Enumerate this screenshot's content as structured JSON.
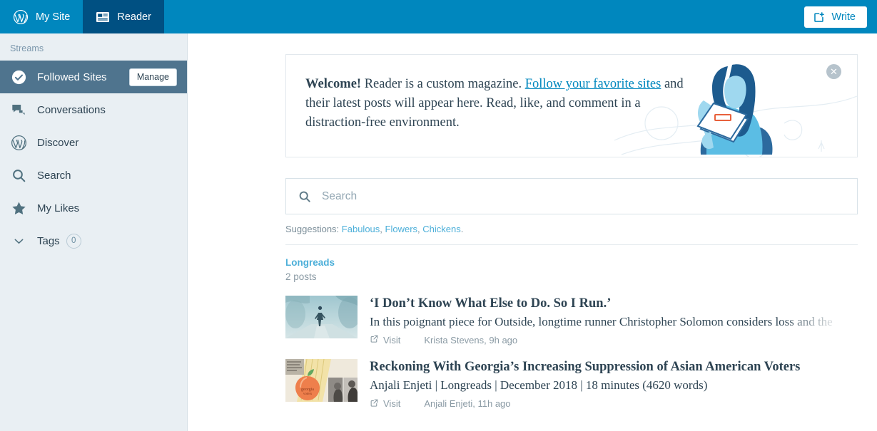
{
  "masterbar": {
    "my_site": "My Site",
    "reader": "Reader",
    "write": "Write",
    "icons": {
      "wordpress": "wordpress-icon",
      "reader": "reader-icon",
      "write": "write-icon"
    }
  },
  "sidebar": {
    "heading": "Streams",
    "items": [
      {
        "label": "Followed Sites",
        "icon": "checkmark-circle-icon",
        "active": true,
        "action_label": "Manage"
      },
      {
        "label": "Conversations",
        "icon": "comments-icon",
        "active": false
      },
      {
        "label": "Discover",
        "icon": "wordpress-icon",
        "active": false
      },
      {
        "label": "Search",
        "icon": "search-icon",
        "active": false
      },
      {
        "label": "My Likes",
        "icon": "star-icon",
        "active": false
      }
    ],
    "tags": {
      "label": "Tags",
      "count": "0",
      "icon": "chevron-down-icon"
    }
  },
  "welcome": {
    "bold": "Welcome!",
    "text_before_link": " Reader is a custom magazine. ",
    "link": "Follow your favorite sites",
    "text_after_link": " and their latest posts will appear here. Read, like, and comment in a distraction-free environment.",
    "close_icon": "close-icon"
  },
  "search": {
    "placeholder": "Search",
    "icon": "search-icon",
    "suggestions_label": "Suggestions:",
    "suggestions": [
      "Fabulous",
      "Flowers",
      "Chickens"
    ]
  },
  "stream": {
    "title": "Longreads",
    "subtitle": "2 posts",
    "posts": [
      {
        "title": "‘I Don’t Know What Else to Do. So I Run.’",
        "excerpt": "In this poignant piece for Outside, longtime runner Christopher Solomon considers loss and the",
        "visit_label": "Visit",
        "byline": "Krista Stevens, 9h ago",
        "thumb": "runner-in-fog-thumbnail"
      },
      {
        "title": "Reckoning With Georgia’s Increasing Suppression of Asian American Voters",
        "excerpt": "Anjali Enjeti | Longreads | December 2018 | 18 minutes (4620 words)",
        "visit_label": "Visit",
        "byline": "Anjali Enjeti, 11h ago",
        "thumb": "peach-collage-thumbnail"
      }
    ]
  },
  "colors": {
    "masterbar": "#0087be",
    "masterbar_active": "#005082",
    "sidebar_bg": "#e9eff3",
    "sidebar_active": "#4f748e",
    "link": "#0087be",
    "stream_link": "#4cafd9",
    "text": "#2e4453"
  }
}
